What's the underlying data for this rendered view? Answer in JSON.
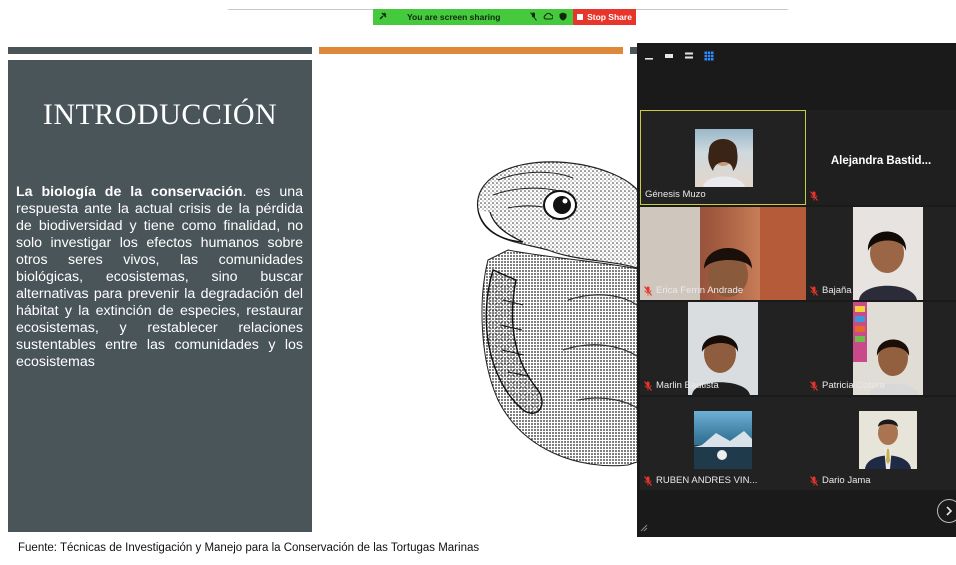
{
  "share_bar": {
    "message": "You are screen sharing",
    "stop_label": "Stop Share"
  },
  "slide": {
    "title": "INTRODUCCIÓN",
    "body_bold": "La biología de la conservación",
    "body_text": ". es una respuesta ante  la actual crisis de la pérdida de biodiversidad y tiene como finalidad, no solo investigar los efectos humanos sobre otros seres vivos, las comunidades biológicas, ecosistemas, sino buscar alternativas para prevenir la degradación del hábitat y la extinción de especies, restaurar ecosistemas, y restablecer relaciones sustentables entre las comunidades y los ecosistemas",
    "source": "Fuente: Técnicas de Investigación y Manejo para la Conservación de las Tortugas Marinas",
    "colors": {
      "panel": "#4a555a",
      "accent": "#e0883a"
    }
  },
  "meeting": {
    "participants": [
      {
        "name": "Génesis Muzo",
        "active": true
      },
      {
        "name": "Alejandra  Bastid..."
      },
      {
        "name": "Erica Ferrin Andrade"
      },
      {
        "name": "Bajaña"
      },
      {
        "name": "Marlin Bautista"
      },
      {
        "name": "Patricia Cotera"
      },
      {
        "name": "RUBEN ANDRES VIN..."
      },
      {
        "name": "Dario Jama"
      }
    ],
    "next_icon": "chevron-right-icon",
    "colors": {
      "active_border": "#c9cf3a",
      "muted_mic": "#e8352c"
    }
  }
}
